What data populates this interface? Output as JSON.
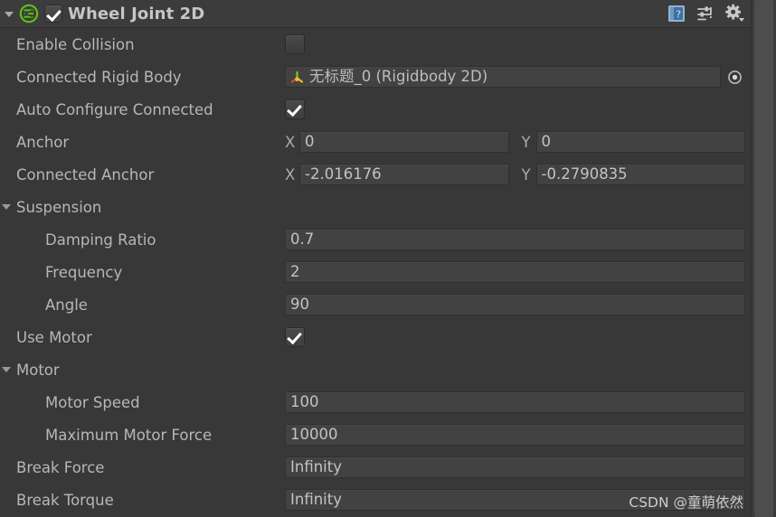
{
  "header": {
    "title": "Wheel Joint 2D",
    "enabled": true,
    "foldout_expanded": true,
    "icons": [
      {
        "name": "help-icon",
        "label": "?"
      },
      {
        "name": "preset-icon",
        "label": "Preset"
      },
      {
        "name": "settings-gear-icon",
        "label": "Settings"
      }
    ]
  },
  "colors": {
    "background": "#383838",
    "header_background": "#3c3c3c",
    "field_background": "#424242",
    "label_text": "#b7b7b7",
    "value_text": "#c3c3c3",
    "component_icon_green": "#5cc115",
    "help_icon_blue": "#7aa8d4",
    "scrollbar_thumb": "#4d4d4d"
  },
  "rows": [
    {
      "kind": "checkbox",
      "label": "Enable Collision",
      "indent": "none",
      "checked": false
    },
    {
      "kind": "object",
      "label": "Connected Rigid Body",
      "indent": "none",
      "value": "无标题_0 (Rigidbody 2D)",
      "icon": "rigidbody2d-axis-icon",
      "picker": "object-picker-icon"
    },
    {
      "kind": "checkbox",
      "label": "Auto Configure Connected",
      "indent": "none",
      "checked": true
    },
    {
      "kind": "vector2",
      "label": "Anchor",
      "indent": "none",
      "x_label": "X",
      "x_value": "0",
      "y_label": "Y",
      "y_value": "0"
    },
    {
      "kind": "vector2",
      "label": "Connected Anchor",
      "indent": "none",
      "x_label": "X",
      "x_value": "-2.016176",
      "y_label": "Y",
      "y_value": "-0.2790835"
    },
    {
      "kind": "foldout",
      "label": "Suspension",
      "indent": "none",
      "expanded": true
    },
    {
      "kind": "text",
      "label": "Damping Ratio",
      "indent": "child",
      "value": "0.7"
    },
    {
      "kind": "text",
      "label": "Frequency",
      "indent": "child",
      "value": "2"
    },
    {
      "kind": "text",
      "label": "Angle",
      "indent": "child",
      "value": "90"
    },
    {
      "kind": "checkbox",
      "label": "Use Motor",
      "indent": "none",
      "checked": true
    },
    {
      "kind": "foldout",
      "label": "Motor",
      "indent": "none",
      "expanded": true
    },
    {
      "kind": "text",
      "label": "Motor Speed",
      "indent": "child",
      "value": "100"
    },
    {
      "kind": "text",
      "label": "Maximum Motor Force",
      "indent": "child",
      "value": "10000"
    },
    {
      "kind": "text",
      "label": "Break Force",
      "indent": "none",
      "value": "Infinity"
    },
    {
      "kind": "text",
      "label": "Break Torque",
      "indent": "none",
      "value": "Infinity"
    }
  ],
  "watermark": {
    "text": "CSDN @童萌依然"
  }
}
